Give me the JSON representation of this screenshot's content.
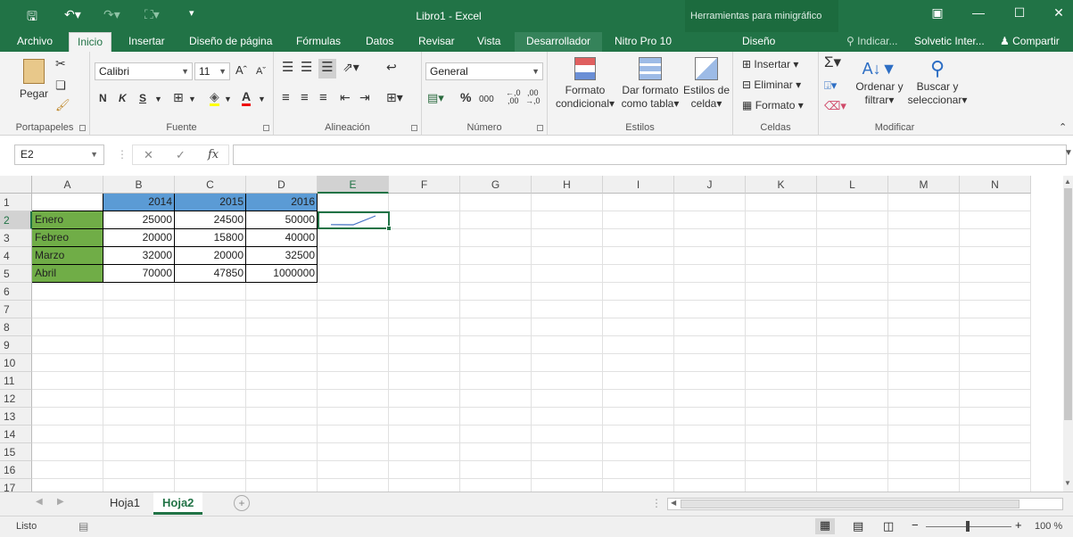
{
  "window": {
    "title": "Libro1 - Excel",
    "context_title": "Herramientas para minigráfico"
  },
  "tabs": [
    {
      "label": "Archivo"
    },
    {
      "label": "Inicio"
    },
    {
      "label": "Insertar"
    },
    {
      "label": "Diseño de página"
    },
    {
      "label": "Fórmulas"
    },
    {
      "label": "Datos"
    },
    {
      "label": "Revisar"
    },
    {
      "label": "Vista"
    },
    {
      "label": "Desarrollador"
    },
    {
      "label": "Nitro Pro 10"
    },
    {
      "label": "Diseño"
    }
  ],
  "tell_me": "Indicar...",
  "user": "Solvetic Inter...",
  "share": "Compartir",
  "ribbon": {
    "clipboard": {
      "label": "Portapapeles",
      "paste": "Pegar"
    },
    "font": {
      "label": "Fuente",
      "name": "Calibri",
      "size": "11",
      "bold": "N",
      "italic": "K",
      "underline": "S",
      "grow": "A",
      "shrink": "A"
    },
    "alignment": {
      "label": "Alineación"
    },
    "number": {
      "label": "Número",
      "format": "General",
      "percent": "%",
      "thousands": "000"
    },
    "styles": {
      "label": "Estilos",
      "cond_line1": "Formato",
      "cond_line2": "condicional",
      "table_line1": "Dar formato",
      "table_line2": "como tabla",
      "cell_line1": "Estilos de",
      "cell_line2": "celda"
    },
    "cells": {
      "label": "Celdas",
      "insert": "Insertar",
      "delete": "Eliminar",
      "format": "Formato"
    },
    "editing": {
      "label": "Modificar",
      "sort_line1": "Ordenar y",
      "sort_line2": "filtrar",
      "find_line1": "Buscar y",
      "find_line2": "seleccionar"
    }
  },
  "formula_bar": {
    "name_box": "E2",
    "fx": "fx",
    "value": ""
  },
  "columns": [
    "A",
    "B",
    "C",
    "D",
    "E",
    "F",
    "G",
    "H",
    "I",
    "J",
    "K",
    "L",
    "M",
    "N"
  ],
  "rows": [
    "1",
    "2",
    "3",
    "4",
    "5",
    "6",
    "7",
    "8",
    "9",
    "10",
    "11",
    "12",
    "13",
    "14",
    "15",
    "16",
    "17"
  ],
  "table": {
    "years": [
      "2014",
      "2015",
      "2016"
    ],
    "data": [
      {
        "month": "Enero",
        "values": [
          "25000",
          "24500",
          "50000"
        ]
      },
      {
        "month": "Febreo",
        "values": [
          "20000",
          "15800",
          "40000"
        ]
      },
      {
        "month": "Marzo",
        "values": [
          "32000",
          "20000",
          "32500"
        ]
      },
      {
        "month": "Abril",
        "values": [
          "70000",
          "47850",
          "1000000"
        ]
      }
    ]
  },
  "sheets": [
    {
      "label": "Hoja1"
    },
    {
      "label": "Hoja2"
    }
  ],
  "status": {
    "ready": "Listo",
    "zoom": "100 %"
  },
  "colors": {
    "excel_green": "#217346",
    "header_blue": "#5b9bd5",
    "month_green": "#70ad47",
    "sparkline": "#4472c4"
  }
}
